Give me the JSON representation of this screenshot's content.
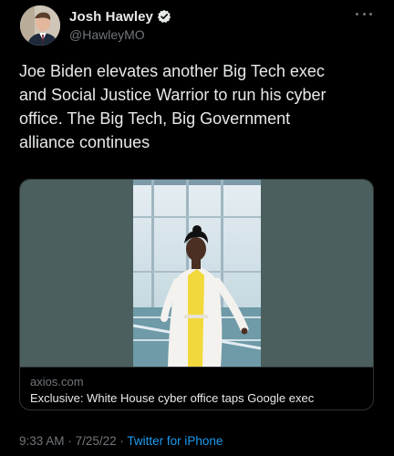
{
  "author": {
    "display_name": "Josh Hawley",
    "handle": "@HawleyMO",
    "verified_icon": "verified-badge-icon"
  },
  "tweet": {
    "text": "Joe Biden elevates another Big Tech exec\nand Social Justice Warrior to run his cyber\noffice. The Big Tech, Big Government\nalliance continues"
  },
  "card": {
    "domain": "axios.com",
    "title": "Exclusive: White House cyber office taps Google exec"
  },
  "meta": {
    "time": "9:33 AM",
    "separator": "·",
    "date": "7/25/22",
    "source": "Twitter for iPhone"
  },
  "colors": {
    "background": "#000000",
    "primary_text": "#e7e9ea",
    "secondary_text": "#71767b",
    "link": "#1d9bf0",
    "verified": "#e7e9ea",
    "card_media_bg": "#4a5f5e"
  }
}
